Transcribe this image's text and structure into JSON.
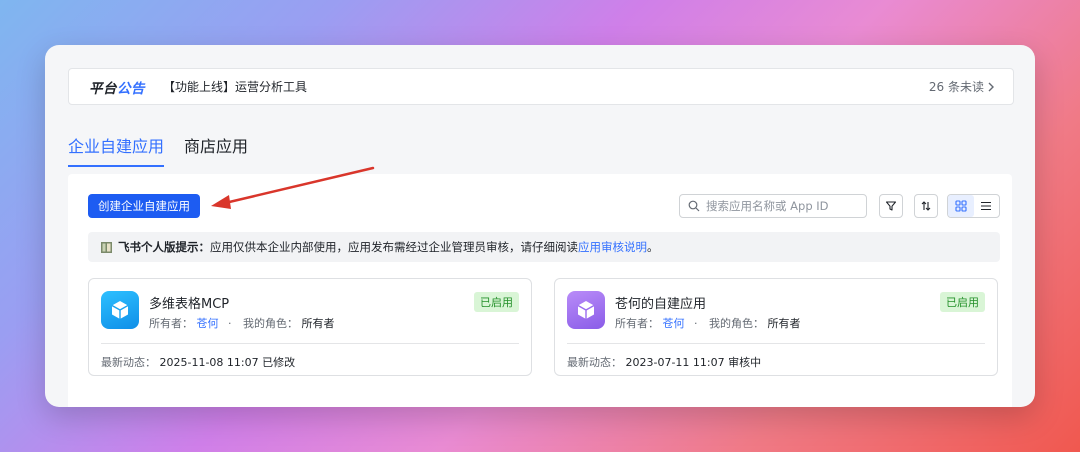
{
  "announcement": {
    "logo_part1": "平台",
    "logo_part2": "公告",
    "message": "【功能上线】运营分析工具",
    "unread": "26 条未读"
  },
  "tabs": [
    {
      "label": "企业自建应用",
      "active": true
    },
    {
      "label": "商店应用",
      "active": false
    }
  ],
  "toolbar": {
    "create_label": "创建企业自建应用",
    "search_placeholder": "搜索应用名称或 App ID"
  },
  "notice": {
    "title": "飞书个人版提示：",
    "text": "应用仅供本企业内部使用，应用发布需经过企业管理员审核，请仔细阅读 ",
    "link": "应用审核说明",
    "end": "。"
  },
  "apps": [
    {
      "name": "多维表格MCP",
      "owner_label": "所有者：",
      "owner": "苍何",
      "sep": "·",
      "role_label": "我的角色：",
      "role": "所有者",
      "status": "已启用",
      "activity_label": "最新动态：",
      "activity": "2025-11-08 11:07 已修改",
      "icon_color": "#1aa3f0"
    },
    {
      "name": "苍何的自建应用",
      "owner_label": "所有者：",
      "owner": "苍何",
      "sep": "·",
      "role_label": "我的角色：",
      "role": "所有者",
      "status": "已启用",
      "activity_label": "最新动态：",
      "activity": "2023-07-11 11:07 审核中",
      "icon_color": "#9b6cf0"
    }
  ],
  "colors": {
    "accent": "#3370ff",
    "primary_button": "#1d5cf2",
    "status_green": "#24912a",
    "annotation_arrow": "#d9362b"
  }
}
